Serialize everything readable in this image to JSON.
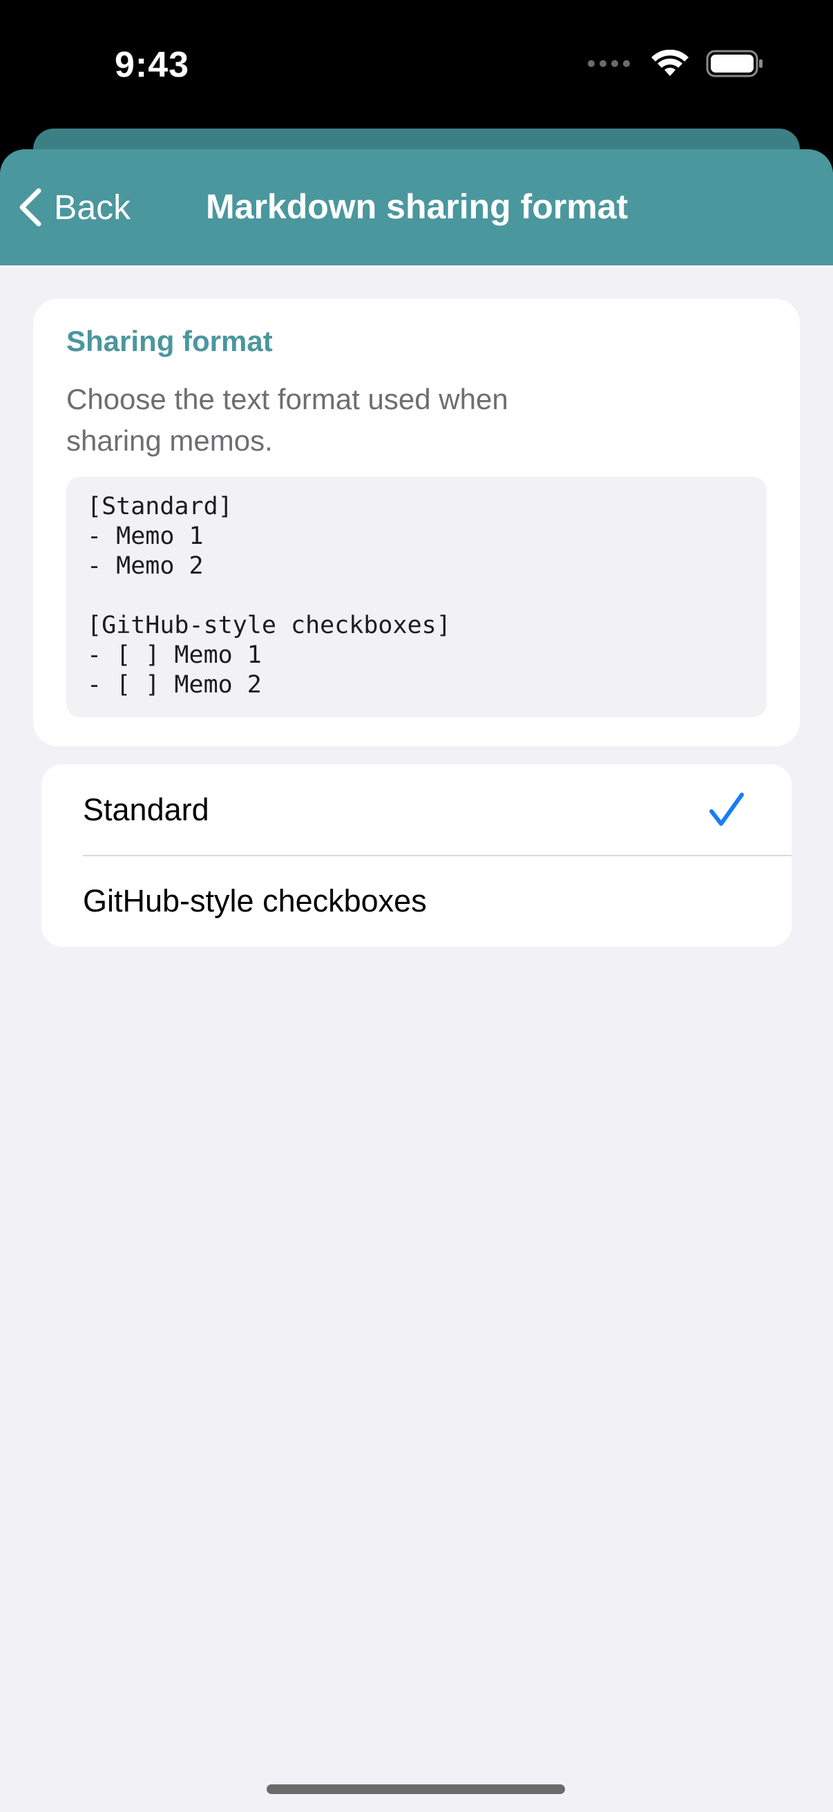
{
  "status_bar": {
    "time": "9:43"
  },
  "nav": {
    "back_label": "Back",
    "title": "Markdown sharing format"
  },
  "info": {
    "title": "Sharing format",
    "description": "Choose the text format used when sharing memos.",
    "example_lines": [
      "[Standard]",
      "- Memo 1",
      "- Memo 2",
      "",
      "[GitHub-style checkboxes]",
      "- [ ] Memo 1",
      "- [ ] Memo 2"
    ]
  },
  "options": [
    {
      "label": "Standard",
      "selected": true
    },
    {
      "label": "GitHub-style checkboxes",
      "selected": false
    }
  ],
  "colors": {
    "accent": "#4a979d",
    "check": "#1a7cf5",
    "background": "#f2f1f6"
  },
  "icons": {
    "back": "chevron-left-icon",
    "wifi": "wifi-icon",
    "battery": "battery-icon",
    "check": "checkmark-icon"
  }
}
